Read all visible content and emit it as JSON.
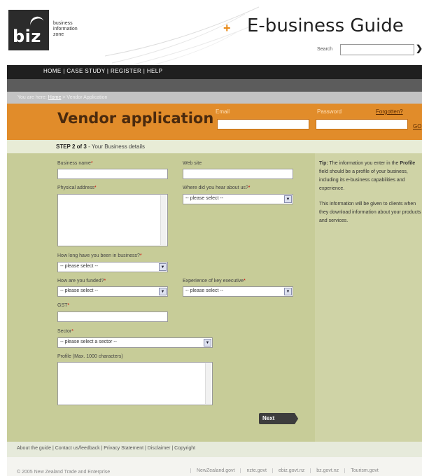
{
  "header": {
    "logo": "biz",
    "tagline": [
      "business",
      "information",
      "zone"
    ],
    "title": "E-business Guide",
    "search_label": "Search",
    "search_value": ""
  },
  "nav": {
    "links": "HOME | CASE STUDY | REGISTER | HELP"
  },
  "breadcrumb": {
    "prefix": "You are here:",
    "home": "Home",
    "current": "> Vendor Application"
  },
  "login": {
    "page_title": "Vendor application",
    "email_label": "Email",
    "email_value": "",
    "password_label": "Password",
    "password_value": "",
    "forgot_label": "Forgotten?",
    "go_label": "GO"
  },
  "step": {
    "label": "STEP 2 of 3",
    "detail": " - Your Business details"
  },
  "form": {
    "business_name_label": "Business name",
    "website_label": "Web site",
    "physical_address_label": "Physical address",
    "hear_label": "Where did you hear about us?",
    "hear_value": "-- please select --",
    "how_long_label": "How long have you been in business?",
    "how_long_value": "-- please select --",
    "funded_label": "How are you funded?",
    "funded_value": "-- please select --",
    "experience_label": "Experience of key executive",
    "experience_value": "-- please select --",
    "gst_label": "GST",
    "sector_label": "Sector",
    "sector_value": "-- please select a sector --",
    "profile_label": "Profile (Max. 1000 characters)",
    "next_label": "Next"
  },
  "tip": {
    "p1_bold1": "Tip:",
    "p1_a": " The information you enter in the ",
    "p1_bold2": "Profile",
    "p1_b": " field should be a profile of your business, including its e-business capabilities and experience.",
    "p2": "This information will be given to clients when they download information about your products and services."
  },
  "footer": {
    "links": "About the guide | Contact us/feedback | Privacy Statement | Disclaimer | Copyright",
    "copyright": "© 2005 New Zealand Trade and Enterprise",
    "bottom_links": [
      "NewZealand.govt",
      "nzte.govt",
      "ebiz.govt.nz",
      "bz.govt.nz",
      "Tourism.govt"
    ]
  }
}
